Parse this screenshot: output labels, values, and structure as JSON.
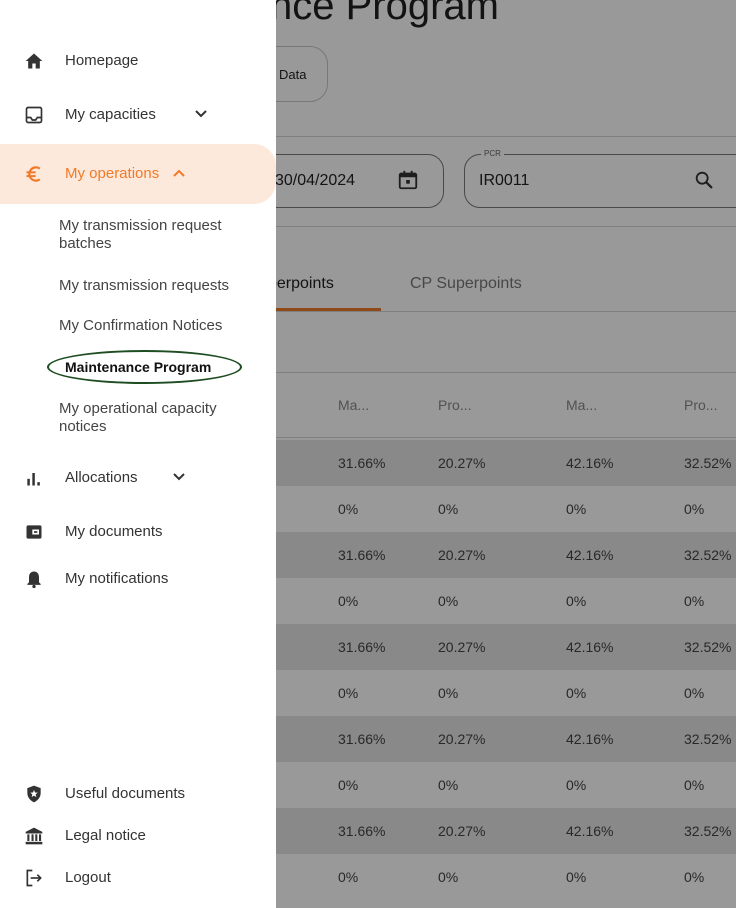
{
  "page": {
    "title": "nce Program",
    "data_button": "Data",
    "date_value": "30/04/2024",
    "pcr_label": "PCR",
    "pcr_value": "IR0011",
    "tabs": [
      "perpoints",
      "CP Superpoints"
    ],
    "columns": [
      "Ma...",
      "Pro...",
      "Ma...",
      "Pro..."
    ],
    "rows": [
      [
        "31.66%",
        "20.27%",
        "42.16%",
        "32.52%"
      ],
      [
        "0%",
        "0%",
        "0%",
        "0%"
      ],
      [
        "31.66%",
        "20.27%",
        "42.16%",
        "32.52%"
      ],
      [
        "0%",
        "0%",
        "0%",
        "0%"
      ],
      [
        "31.66%",
        "20.27%",
        "42.16%",
        "32.52%"
      ],
      [
        "0%",
        "0%",
        "0%",
        "0%"
      ],
      [
        "31.66%",
        "20.27%",
        "42.16%",
        "32.52%"
      ],
      [
        "0%",
        "0%",
        "0%",
        "0%"
      ],
      [
        "31.66%",
        "20.27%",
        "42.16%",
        "32.52%"
      ],
      [
        "0%",
        "0%",
        "0%",
        "0%"
      ]
    ]
  },
  "sidebar": {
    "homepage": "Homepage",
    "capacities": "My capacities",
    "operations": "My operations",
    "operations_sub": [
      "My transmission request batches",
      "My transmission requests",
      "My Confirmation Notices",
      "Maintenance Program",
      "My operational capacity notices"
    ],
    "allocations": "Allocations",
    "documents": "My documents",
    "notifications": "My notifications",
    "useful_documents": "Useful documents",
    "legal_notice": "Legal notice",
    "logout": "Logout"
  },
  "colors": {
    "accent": "#f07a28",
    "active_bg": "#fde9dc",
    "focus_ring": "#1e4d22"
  }
}
